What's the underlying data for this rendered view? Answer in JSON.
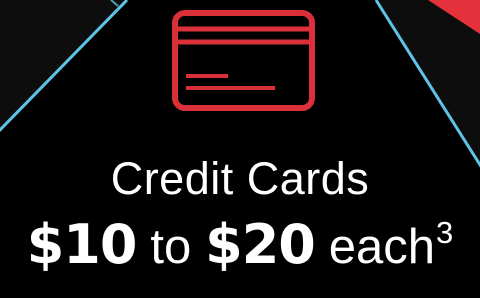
{
  "promo": {
    "title": "Credit Cards",
    "price_low": "$10",
    "connector": "to",
    "price_high": "$20",
    "unit": "each",
    "footnote_marker": "3"
  },
  "icons": {
    "card": "credit-card-icon"
  },
  "colors": {
    "background": "#000000",
    "text": "#ffffff",
    "icon_red": "#d9303a",
    "accent_blue": "#5fc3e6",
    "accent_red": "#e3323b"
  }
}
